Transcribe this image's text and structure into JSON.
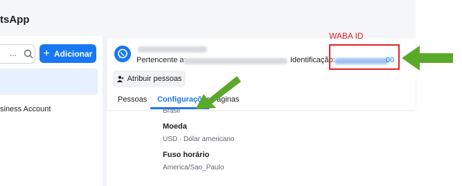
{
  "app": {
    "title_fragment": "tsApp"
  },
  "sidebar": {
    "search_placeholder": "...",
    "add_button_label": "Adicionar",
    "items": [
      {
        "label": "siness Account"
      }
    ]
  },
  "account": {
    "owner_label": "Pertencente a:",
    "id_label": "Identificação:",
    "id_visible_suffix": "00",
    "assign_button_label": "Atribuir pessoas"
  },
  "tabs": [
    {
      "label": "Pessoas",
      "active": false
    },
    {
      "label": "Configurações",
      "active": true
    },
    {
      "label": "áginas",
      "active": false
    }
  ],
  "settings": {
    "country_value": "Brasil",
    "currency_label": "Moeda",
    "currency_value": "USD · Dólar americano",
    "timezone_label": "Fuso horário",
    "timezone_value": "America/Sao_Paulo"
  },
  "annotation": {
    "label": "WABA ID",
    "box_color": "#e0202a",
    "arrow_color": "#5aa92a"
  },
  "colors": {
    "accent": "#1877f2",
    "selected_row": "#e7f0fd"
  },
  "icons": {
    "search": "search-icon",
    "whatsapp": "whatsapp-icon",
    "person": "person-icon",
    "plus": "plus-icon"
  }
}
